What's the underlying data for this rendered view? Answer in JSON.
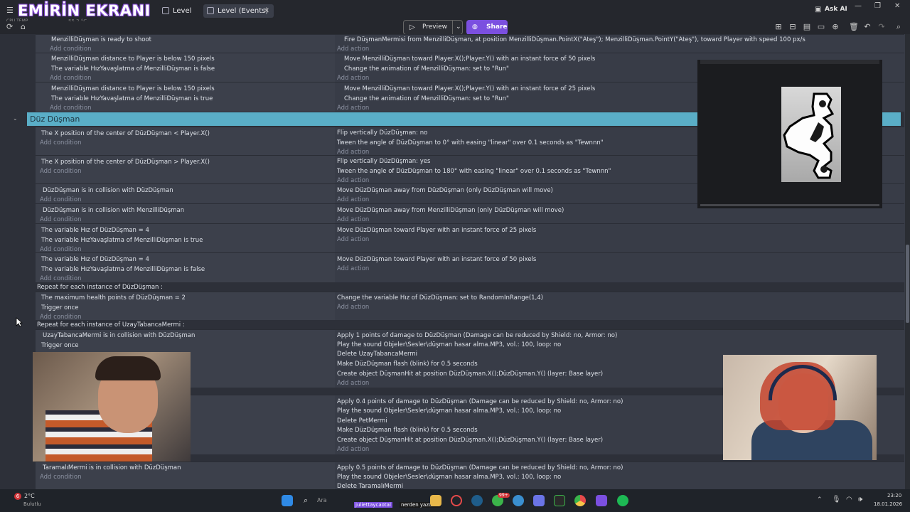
{
  "watermark": "EMİRİN EKRANI",
  "tabs": [
    {
      "label": "Level"
    },
    {
      "label": "Level (Events)"
    }
  ],
  "system_small": {
    "cpu": "CPU TEMP",
    "temp": "55.2 °C"
  },
  "toolbar": {
    "preview": "Preview",
    "share": "Share",
    "ask_ai": "Ask AI"
  },
  "colors": {
    "accent": "#7b4fe0",
    "group_header": "#5aaec7",
    "object_name": "#c78fdc"
  },
  "group_title": "Düz Düşman",
  "top_rows": [
    {
      "conditions": [
        "MenzilliDüşman is ready to shoot"
      ],
      "actions": [
        "Fire DüşmanMermisi from MenzilliDüşman, at position MenzilliDüşman.PointX(\"Ateş\"); MenzilliDüşman.PointY(\"Ateş\"), toward Player with speed 100 px/s"
      ]
    },
    {
      "conditions": [
        "MenzilliDüşman distance to Player is below 150 pixels",
        "The variable HızYavaşlatma of MenzilliDüşman is false"
      ],
      "actions": [
        "Move MenzilliDüşman toward Player.X();Player.Y() with an instant force of 50 pixels",
        "Change the animation of MenzilliDüşman: set to \"Run\""
      ]
    },
    {
      "conditions": [
        "MenzilliDüşman distance to Player is below 150 pixels",
        "The variable HızYavaşlatma of MenzilliDüşman is true"
      ],
      "actions": [
        "Move MenzilliDüşman toward Player.X();Player.Y() with an instant force of 25 pixels",
        "Change the animation of MenzilliDüşman: set to \"Run\""
      ]
    }
  ],
  "rows": [
    {
      "conditions": [
        "The X position of the center of DüzDüşman < Player.X()"
      ],
      "actions": [
        "Flip vertically DüzDüşman: no",
        "Tween the angle of DüzDüşman to 0° with easing \"linear\" over 0.1 seconds as \"Tewnnn\""
      ]
    },
    {
      "conditions": [
        "The X position of the center of DüzDüşman > Player.X()"
      ],
      "actions": [
        "Flip vertically DüzDüşman: yes",
        "Tween the angle of DüzDüşman to 180° with easing \"linear\" over 0.1 seconds as \"Tewnnn\""
      ]
    },
    {
      "conditions": [
        "DüzDüşman is in collision with DüzDüşman"
      ],
      "actions": [
        "Move DüzDüşman away from DüzDüşman (only DüzDüşman will move)"
      ]
    },
    {
      "conditions": [
        "DüzDüşman is in collision with MenzilliDüşman"
      ],
      "actions": [
        "Move DüzDüşman away from MenzilliDüşman (only DüzDüşman will move)"
      ]
    },
    {
      "conditions": [
        "The variable Hız of DüzDüşman = 4",
        "The variable HızYavaşlatma of MenzilliDüşman is true"
      ],
      "actions": [
        "Move DüzDüşman toward Player with an instant force of 25 pixels"
      ]
    },
    {
      "conditions": [
        "The variable Hız of DüzDüşman = 4",
        "The variable HızYavaşlatma of MenzilliDüşman is false"
      ],
      "actions": [
        "Move DüzDüşman toward Player with an instant force of 50 pixels"
      ]
    }
  ],
  "repeat1": {
    "label": "Repeat for each instance of DüzDüşman :",
    "conditions": [
      "The maximum health points of DüzDüşman = 2",
      "Trigger once"
    ],
    "actions": [
      "Change the variable Hız of DüzDüşman: set to RandomInRange(1,4)"
    ]
  },
  "repeat2": {
    "label": "Repeat for each instance of UzayTabancaMermi :",
    "conditions": [
      "UzayTabancaMermi is in collision with DüzDüşman",
      "Trigger once"
    ],
    "actions": [
      "Apply 1 points of damage to DüzDüşman (Damage can be reduced by Shield: no, Armor: no)",
      "Play the sound Objeler\\Sesler\\düşman hasar alma.MP3, vol.: 100, loop: no",
      "Delete UzayTabancaMermi",
      "Make DüzDüşman flash (blink) for 0.5 seconds",
      "Create object DüşmanHit at position DüzDüşman.X();DüzDüşman.Y() (layer: Base layer)"
    ]
  },
  "pet_actions": [
    "Apply 0.4 points of damage to DüzDüşman (Damage can be reduced by Shield: no, Armor: no)",
    "Play the sound Objeler\\Sesler\\düşman hasar alma.MP3, vol.: 100, loop: no",
    "Delete PetMermi",
    "Make DüzDüşman flash (blink) for 0.5 seconds",
    "Create object DüşmanHit at position DüzDüşman.X();DüzDüşman.Y() (layer: Base layer)"
  ],
  "taramali": {
    "conditions": [
      "TaramalıMermi is in collision with DüzDüşman"
    ],
    "actions": [
      "Apply 0.5 points of damage to DüzDüşman (Damage can be reduced by Shield: no, Armor: no)",
      "Play the sound Objeler\\Sesler\\düşman hasar alma.MP3, vol.: 100, loop: no",
      "Delete TaramalıMermi"
    ]
  },
  "add_condition": "Add condition",
  "add_action": "Add action",
  "taskbar": {
    "weather_temp": "2°C",
    "weather_label": "Bulutlu",
    "search": "Ara",
    "chat_user": "juliettaycaotal",
    "chat_text": "nerden yazdınn",
    "badge": "99+",
    "time": "23:20",
    "date": "18.01.2026",
    "weather_badge": "6"
  }
}
